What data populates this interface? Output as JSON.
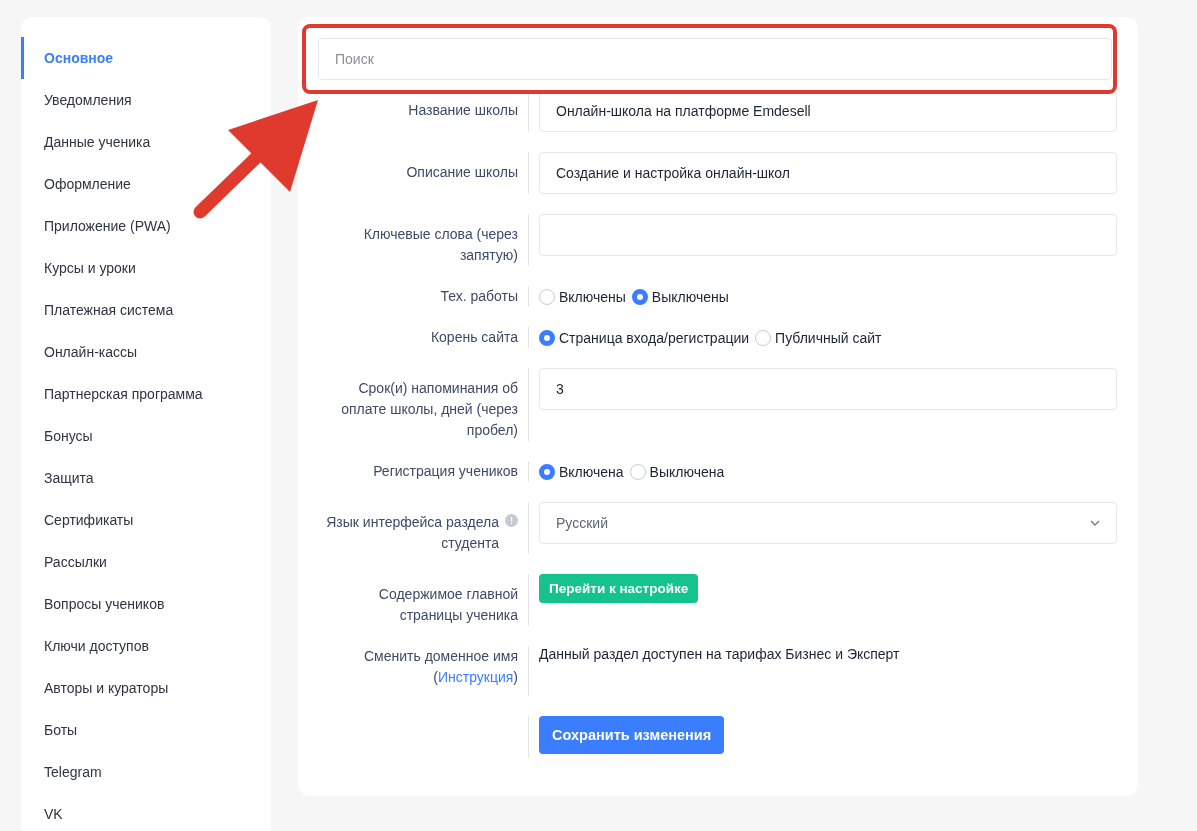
{
  "sidebar": {
    "items": [
      {
        "label": "Основное",
        "selected": true
      },
      {
        "label": "Уведомления",
        "selected": false
      },
      {
        "label": "Данные ученика",
        "selected": false
      },
      {
        "label": "Оформление",
        "selected": false
      },
      {
        "label": "Приложение (PWA)",
        "selected": false
      },
      {
        "label": "Курсы и уроки",
        "selected": false
      },
      {
        "label": "Платежная система",
        "selected": false
      },
      {
        "label": "Онлайн-кассы",
        "selected": false
      },
      {
        "label": "Партнерская программа",
        "selected": false
      },
      {
        "label": "Бонусы",
        "selected": false
      },
      {
        "label": "Защита",
        "selected": false
      },
      {
        "label": "Сертификаты",
        "selected": false
      },
      {
        "label": "Рассылки",
        "selected": false
      },
      {
        "label": "Вопросы учеников",
        "selected": false
      },
      {
        "label": "Ключи доступов",
        "selected": false
      },
      {
        "label": "Авторы и кураторы",
        "selected": false
      },
      {
        "label": "Боты",
        "selected": false
      },
      {
        "label": "Telegram",
        "selected": false
      },
      {
        "label": "VK",
        "selected": false
      }
    ]
  },
  "search": {
    "placeholder": "Поиск"
  },
  "form": {
    "rows": [
      {
        "kind": "text",
        "label": "Название школы",
        "value": "Онлайн-школа на платформе Emdesell"
      },
      {
        "kind": "text",
        "label": "Описание школы",
        "value": "Создание и настройка онлайн-школ"
      },
      {
        "kind": "text",
        "label": "Ключевые слова (через запятую)"
      },
      {
        "kind": "radio",
        "label": "Тех. работы",
        "options": [
          {
            "label": "Включены",
            "selected": false
          },
          {
            "label": "Выключены",
            "selected": true
          }
        ]
      },
      {
        "kind": "radio",
        "label": "Корень сайта",
        "options": [
          {
            "label": "Страница входа/регистрации",
            "selected": true
          },
          {
            "label": "Публичный сайт",
            "selected": false
          }
        ]
      },
      {
        "kind": "text",
        "label": "Срок(и) напоминания об оплате школы, дней (через пробел)",
        "value": "3"
      },
      {
        "kind": "radio",
        "label": "Регистрация учеников",
        "options": [
          {
            "label": "Включена",
            "selected": true
          },
          {
            "label": "Выключена",
            "selected": false
          }
        ]
      },
      {
        "kind": "select",
        "label": "Язык интерфейса раздела студента",
        "info": true,
        "value": "Русский"
      },
      {
        "kind": "button",
        "label": "Содержимое главной страницы ученика",
        "button": "Перейти к настройке"
      },
      {
        "kind": "note",
        "label_before": "Сменить доменное имя (",
        "link": "Инструкция",
        "label_after": ")",
        "text": "Данный раздел доступен на тарифах Бизнес и Эксперт"
      },
      {
        "kind": "save",
        "button": "Сохранить изменения"
      }
    ]
  },
  "annotation": {
    "highlight": true,
    "arrow": true
  }
}
